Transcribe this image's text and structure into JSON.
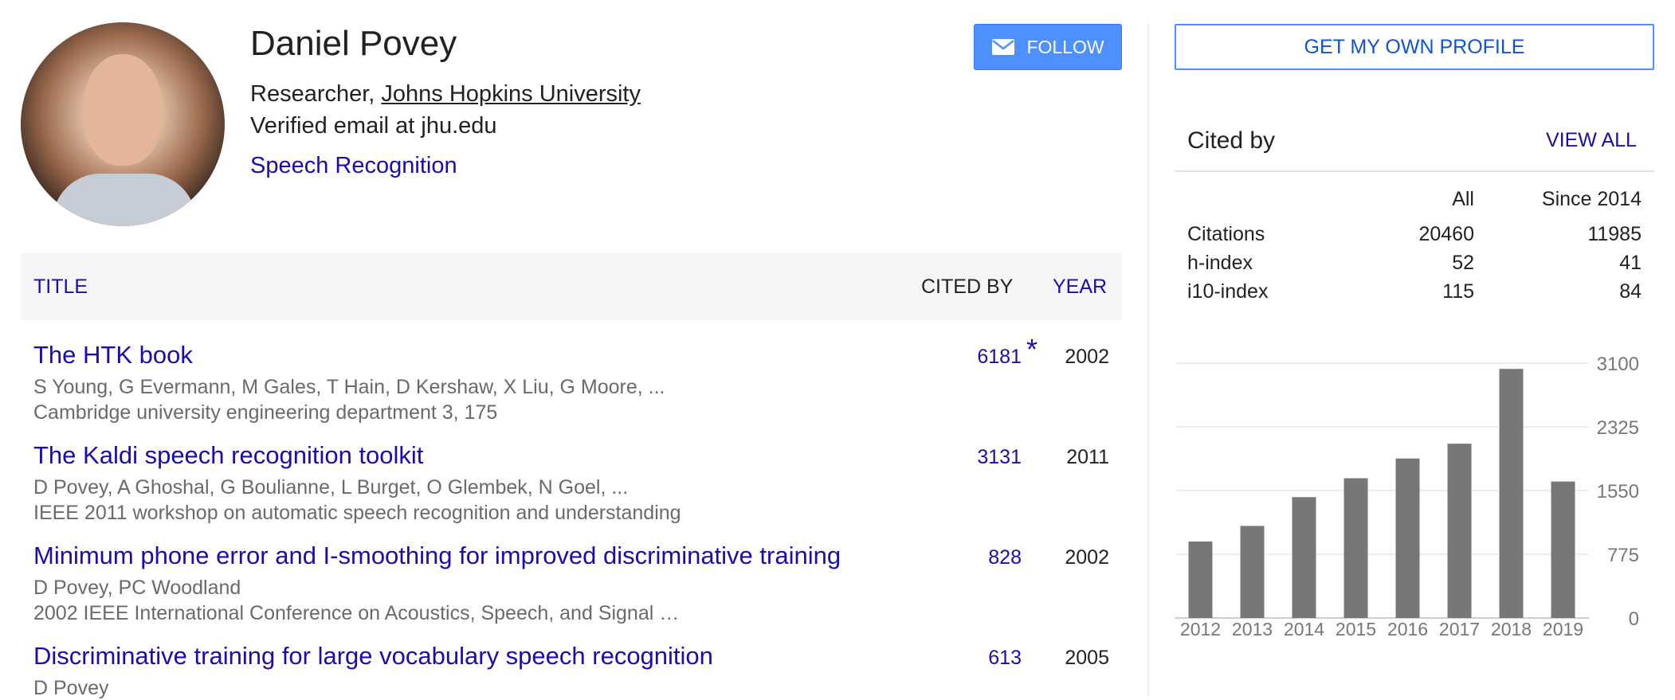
{
  "profile": {
    "name": "Daniel Povey",
    "role_prefix": "Researcher, ",
    "affiliation": "Johns Hopkins University",
    "email": "Verified email at jhu.edu",
    "interest": "Speech Recognition"
  },
  "buttons": {
    "follow": "FOLLOW",
    "own_profile": "GET MY OWN PROFILE"
  },
  "table": {
    "headers": {
      "title": "TITLE",
      "cited_by": "CITED BY",
      "year": "YEAR"
    },
    "rows": [
      {
        "title": "The HTK book",
        "authors": "S Young, G Evermann, M Gales, T Hain, D Kershaw, X Liu, G Moore, ...",
        "venue": "Cambridge university engineering department 3, 175",
        "cited": "6181",
        "star": "*",
        "year": "2002"
      },
      {
        "title": "The Kaldi speech recognition toolkit",
        "authors": "D Povey, A Ghoshal, G Boulianne, L Burget, O Glembek, N Goel, ...",
        "venue": "IEEE 2011 workshop on automatic speech recognition and understanding",
        "cited": "3131",
        "star": "",
        "year": "2011"
      },
      {
        "title": "Minimum phone error and I-smoothing for improved discriminative training",
        "authors": "D Povey, PC Woodland",
        "venue": "2002 IEEE International Conference on Acoustics, Speech, and Signal …",
        "cited": "828",
        "star": "",
        "year": "2002"
      },
      {
        "title": "Discriminative training for large vocabulary speech recognition",
        "authors": "D Povey",
        "venue": "",
        "cited": "613",
        "star": "",
        "year": "2005"
      }
    ]
  },
  "cited_by": {
    "title": "Cited by",
    "view_all": "VIEW ALL",
    "columns": {
      "all": "All",
      "since": "Since 2014"
    },
    "rows": [
      {
        "label": "Citations",
        "all": "20460",
        "since": "11985"
      },
      {
        "label": "h-index",
        "all": "52",
        "since": "41"
      },
      {
        "label": "i10-index",
        "all": "115",
        "since": "84"
      }
    ]
  },
  "chart_data": {
    "type": "bar",
    "categories": [
      "2012",
      "2013",
      "2014",
      "2015",
      "2016",
      "2017",
      "2018",
      "2019"
    ],
    "values": [
      930,
      1120,
      1470,
      1700,
      1940,
      2120,
      3030,
      1660
    ],
    "y_ticks": [
      "0",
      "775",
      "1550",
      "2325",
      "3100"
    ],
    "ylim": [
      0,
      3100
    ],
    "grid": true,
    "bar_color": "#777777"
  },
  "colors": {
    "link": "#1a0dab",
    "accent": "#4d90fe"
  }
}
